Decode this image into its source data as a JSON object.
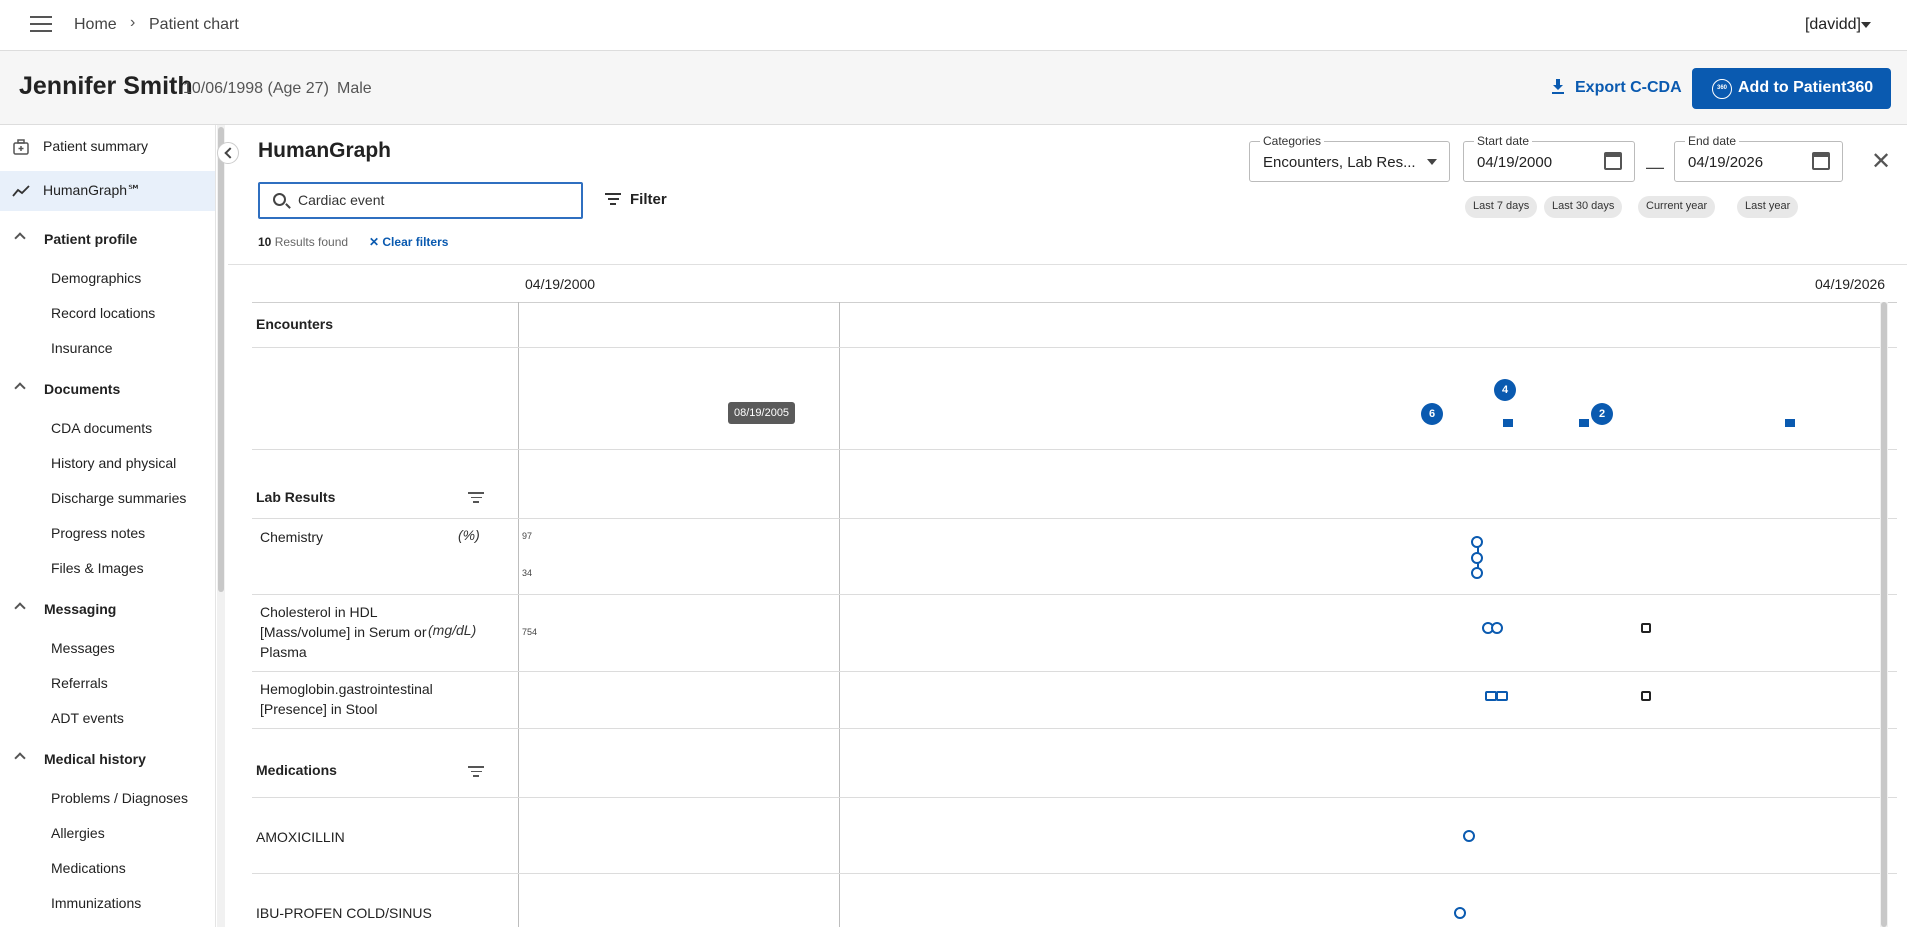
{
  "topbar": {
    "breadcrumb": [
      "Home",
      "Patient chart"
    ],
    "user": "[davidd]"
  },
  "patient": {
    "name": "Jennifer Smith",
    "dob": "10/06/1998 (Age 27)",
    "sex": "Male"
  },
  "actions": {
    "export": "Export C-CDA",
    "add": "Add to Patient360",
    "add_icon": "360"
  },
  "sidebar": {
    "top": [
      {
        "label": "Patient summary",
        "icon": "briefcase-medical-icon"
      },
      {
        "label": "HumanGraph℠",
        "icon": "trend-line-icon"
      }
    ],
    "groups": [
      {
        "label": "Patient profile",
        "items": [
          "Demographics",
          "Record locations",
          "Insurance"
        ]
      },
      {
        "label": "Documents",
        "items": [
          "CDA documents",
          "History and physical",
          "Discharge summaries",
          "Progress notes",
          "Files & Images"
        ]
      },
      {
        "label": "Messaging",
        "items": [
          "Messages",
          "Referrals",
          "ADT events"
        ]
      },
      {
        "label": "Medical history",
        "items": [
          "Problems / Diagnoses",
          "Allergies",
          "Medications",
          "Immunizations"
        ]
      }
    ]
  },
  "main": {
    "title": "HumanGraph",
    "search_value": "Cardiac event",
    "filter": "Filter",
    "results_count": "10",
    "results_text": " Results found",
    "clear": "Clear filters",
    "categories_label": "Categories",
    "categories_value": "Encounters, Lab Res...",
    "start_label": "Start date",
    "start_value": "04/19/2000",
    "end_label": "End date",
    "end_value": "04/19/2026",
    "chips": [
      "Last 7 days",
      "Last 30 days",
      "Current year",
      "Last year"
    ]
  },
  "timeline": {
    "start": "04/19/2000",
    "end": "04/19/2026",
    "tooltip": "08/19/2005",
    "sections": {
      "encounters": "Encounters",
      "lab": "Lab Results",
      "meds": "Medications"
    },
    "lab_rows": [
      {
        "label": "Chemistry",
        "unit": "(%)",
        "ticks": [
          "97",
          "34"
        ]
      },
      {
        "label": "Cholesterol in HDL [Mass/volume] in Serum or Plasma",
        "unit": "(mg/dL)",
        "ticks": [
          "754"
        ]
      },
      {
        "label": "Hemoglobin.gastrointestinal [Presence] in Stool",
        "unit": "",
        "ticks": []
      }
    ],
    "med_rows": [
      "AMOXICILLIN",
      "IBU-PROFEN COLD/SINUS"
    ],
    "badges": [
      "6",
      "4",
      "2"
    ]
  },
  "colors": {
    "accent": "#0a5ab0",
    "active_nav": "#e8f0fa"
  }
}
